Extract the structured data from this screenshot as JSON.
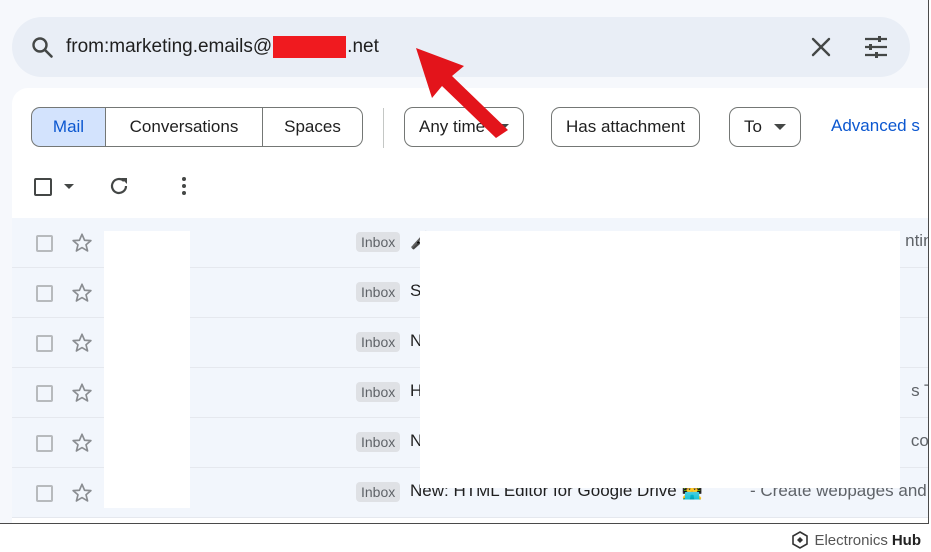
{
  "search": {
    "query_prefix": "from:marketing.emails@",
    "query_suffix": ".net",
    "redaction_color": "#f01a1f"
  },
  "view_toggle": {
    "items": [
      {
        "label": "Mail",
        "selected": true
      },
      {
        "label": "Conversations",
        "selected": false
      },
      {
        "label": "Spaces",
        "selected": false
      }
    ]
  },
  "filters": {
    "any_time": "Any time",
    "has_attachment": "Has attachment",
    "to": "To",
    "advanced": "Advanced s"
  },
  "emails": [
    {
      "label": "Inbox",
      "subject": "🎤",
      "tail": "nting"
    },
    {
      "label": "Inbox",
      "subject": "S",
      "tail": ""
    },
    {
      "label": "Inbox",
      "subject": "N",
      "tail": ""
    },
    {
      "label": "Inbox",
      "subject": "H",
      "tail": "s Te"
    },
    {
      "label": "Inbox",
      "subject": "N",
      "tail": "colo"
    },
    {
      "label": "Inbox",
      "subject": "New: HTML Editor for Google Drive 👨‍💻",
      "snippet": "- Create webpages and c",
      "tail": ""
    }
  ],
  "brand": {
    "name_prefix": "Electronics",
    "name_suffix": "Hub"
  },
  "colors": {
    "accent": "#0b57d0",
    "selected_bg": "#d3e3fd",
    "search_bg": "#e9eef6",
    "arrow": "#e3141b"
  }
}
